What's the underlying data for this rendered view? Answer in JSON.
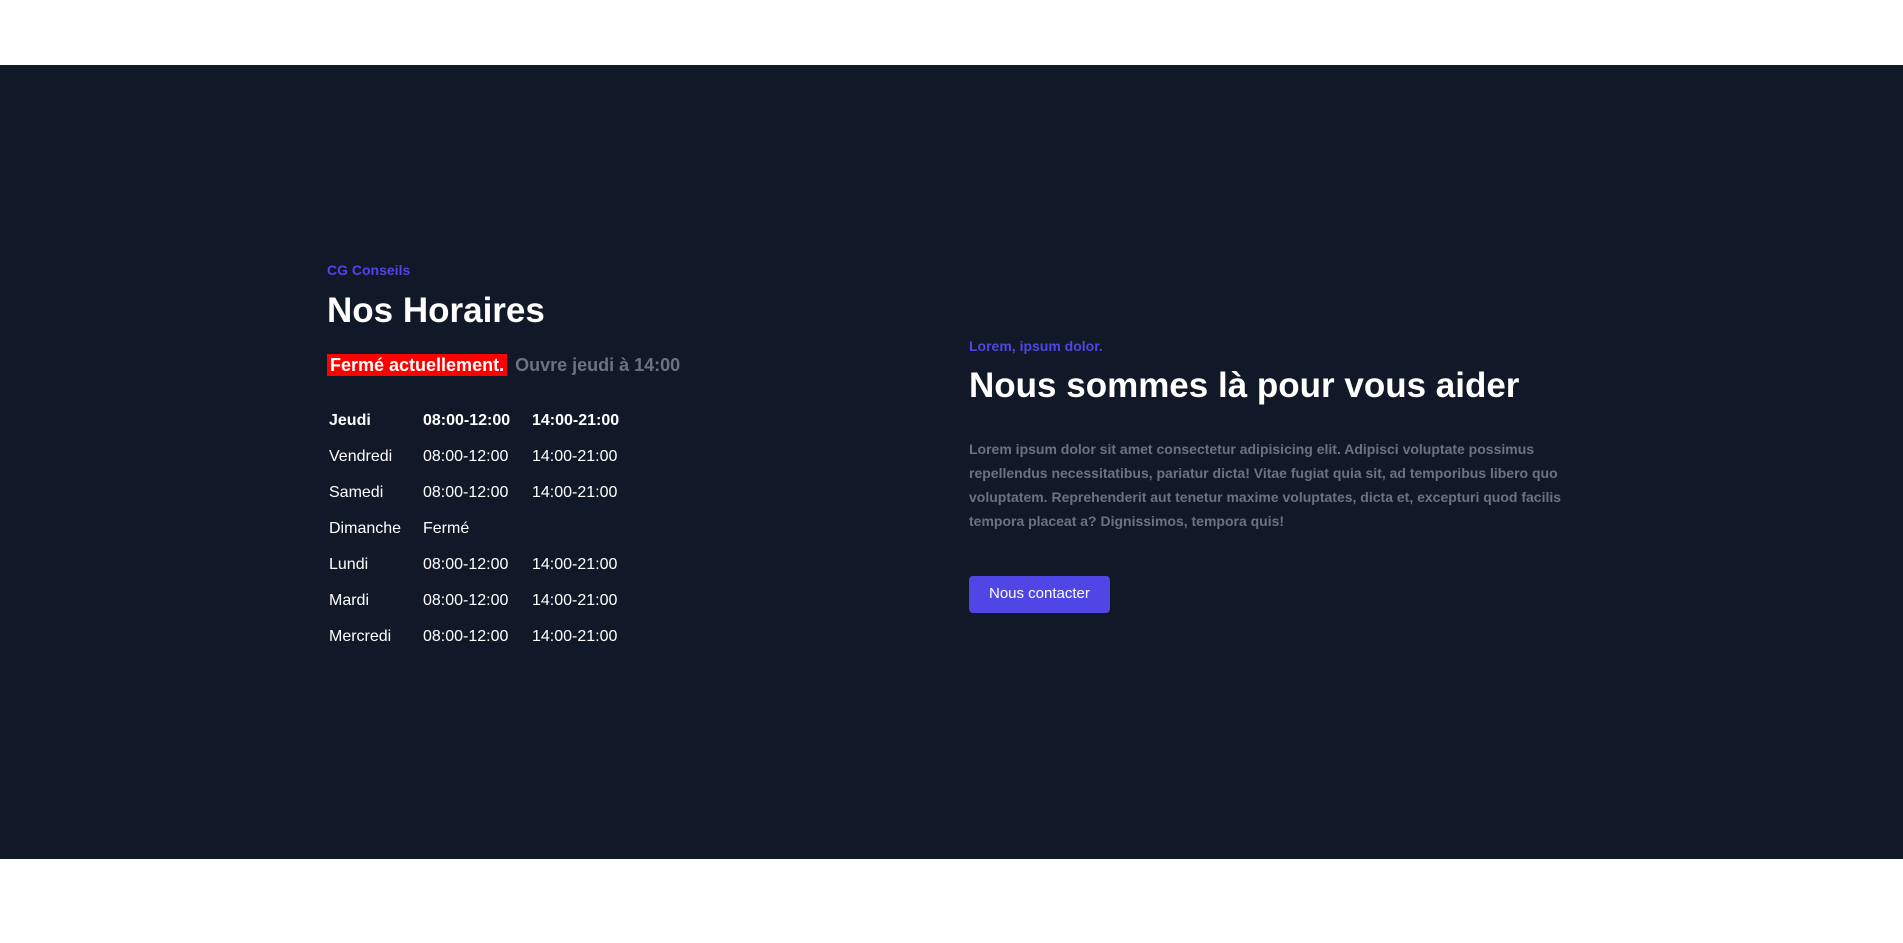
{
  "schedule": {
    "eyebrow": "CG Conseils",
    "title": "Nos Horaires",
    "status_closed": "Fermé actuellement.",
    "status_next_open": "Ouvre jeudi à 14:00",
    "rows": [
      {
        "day": "Jeudi",
        "am": "08:00-12:00",
        "pm": "14:00-21:00",
        "today": true
      },
      {
        "day": "Vendredi",
        "am": "08:00-12:00",
        "pm": "14:00-21:00"
      },
      {
        "day": "Samedi",
        "am": "08:00-12:00",
        "pm": "14:00-21:00"
      },
      {
        "day": "Dimanche",
        "am": "Fermé",
        "pm": ""
      },
      {
        "day": "Lundi",
        "am": "08:00-12:00",
        "pm": "14:00-21:00"
      },
      {
        "day": "Mardi",
        "am": "08:00-12:00",
        "pm": "14:00-21:00"
      },
      {
        "day": "Mercredi",
        "am": "08:00-12:00",
        "pm": "14:00-21:00"
      }
    ]
  },
  "contact": {
    "eyebrow": "Lorem, ipsum dolor.",
    "title": "Nous sommes là pour vous aider",
    "text": "Lorem ipsum dolor sit amet consectetur adipisicing elit. Adipisci voluptate possimus repellendus necessitatibus, pariatur dicta! Vitae fugiat quia sit, ad temporibus libero quo voluptatem. Reprehenderit aut tenetur maxime voluptates, dicta et, excepturi quod facilis tempora placeat a? Dignissimos, tempora quis!",
    "button_label": "Nous contacter"
  },
  "colors": {
    "background": "#111827",
    "accent": "#4f46e5",
    "closed_badge": "#ff0000",
    "muted_text": "#6b7280"
  }
}
